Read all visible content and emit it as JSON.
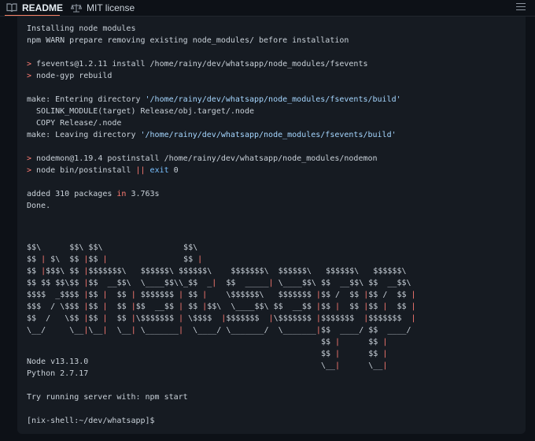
{
  "tabs": [
    {
      "label": "README",
      "icon": "book-icon"
    },
    {
      "label": "MIT license",
      "icon": "scale-icon"
    }
  ],
  "terminal": {
    "lines": [
      {
        "text": "Installing node modules"
      },
      {
        "text": "npm WARN prepare removing existing node_modules/ before installation"
      },
      {
        "text": ""
      },
      {
        "prompt": "> ",
        "text": "fsevents@1.2.11 install /home/rainy/dev/whatsapp/node_modules/fsevents"
      },
      {
        "prompt": "> ",
        "text": "node-gyp rebuild"
      },
      {
        "text": ""
      },
      {
        "pre": "make: Entering directory ",
        "path": "'/home/rainy/dev/whatsapp/node_modules/fsevents/build'"
      },
      {
        "text": "  SOLINK_MODULE(target) Release/obj.target/.node"
      },
      {
        "text": "  COPY Release/.node"
      },
      {
        "pre": "make: Leaving directory ",
        "path": "'/home/rainy/dev/whatsapp/node_modules/fsevents/build'"
      },
      {
        "text": ""
      },
      {
        "prompt": "> ",
        "text": "nodemon@1.19.4 postinstall /home/rainy/dev/whatsapp/node_modules/nodemon"
      },
      {
        "prompt": "> ",
        "pre": "node bin/postinstall ",
        "op": "||",
        "kw": " exit ",
        "num": "0"
      },
      {
        "text": ""
      },
      {
        "pre": "added 310 packages ",
        "kw": "in",
        "num": " 3.763s"
      },
      {
        "text": "Done."
      }
    ],
    "ascii_art": [
      "$$\\      $$\\ $$\\                 $$\\",
      "$$ | $\\  $$ |$$ |                $$ |",
      "$$ |$$$\\ $$ |$$$$$$$\\   $$$$$$\\ $$$$$$\\    $$$$$$$\\  $$$$$$\\   $$$$$$\\   $$$$$$\\",
      "$$ $$ $$\\$$ |$$  __$$\\  \\____$$\\\\_$$  _|  $$  _____| \\____$$\\ $$  __$$\\ $$  __$$\\",
      "$$$$  _$$$$ |$$ |  $$ | $$$$$$$ | $$ |    \\$$$$$$\\   $$$$$$$ |$$ /  $$ |$$ /  $$ |",
      "$$$  / \\$$$ |$$ |  $$ |$$  __$$ | $$ |$$\\  \\____$$\\ $$  __$$ |$$ |  $$ |$$ |  $$ |",
      "$$  /   \\$$ |$$ |  $$ |\\$$$$$$$ | \\$$$$  |$$$$$$$  |\\$$$$$$$ |$$$$$$$  |$$$$$$$  |",
      "\\__/     \\__|\\__|  \\__| \\_______|  \\____/ \\_______/  \\_______|$$  ____/ $$  ____/",
      "                                                              $$ |      $$ |",
      "                                                              $$ |      $$ |",
      "                                                              \\__|      \\__|"
    ],
    "footer": [
      "Node v13.13.0",
      "Python 2.7.17",
      "",
      "Try running server with: npm start",
      "",
      "[nix-shell:~/dev/whatsapp]$"
    ]
  },
  "colors": {
    "background": "#0d1117",
    "terminal_bg": "#161b22",
    "accent_red": "#ff7b72",
    "path_blue": "#a5d6ff",
    "keyword_blue": "#79c0ff"
  }
}
